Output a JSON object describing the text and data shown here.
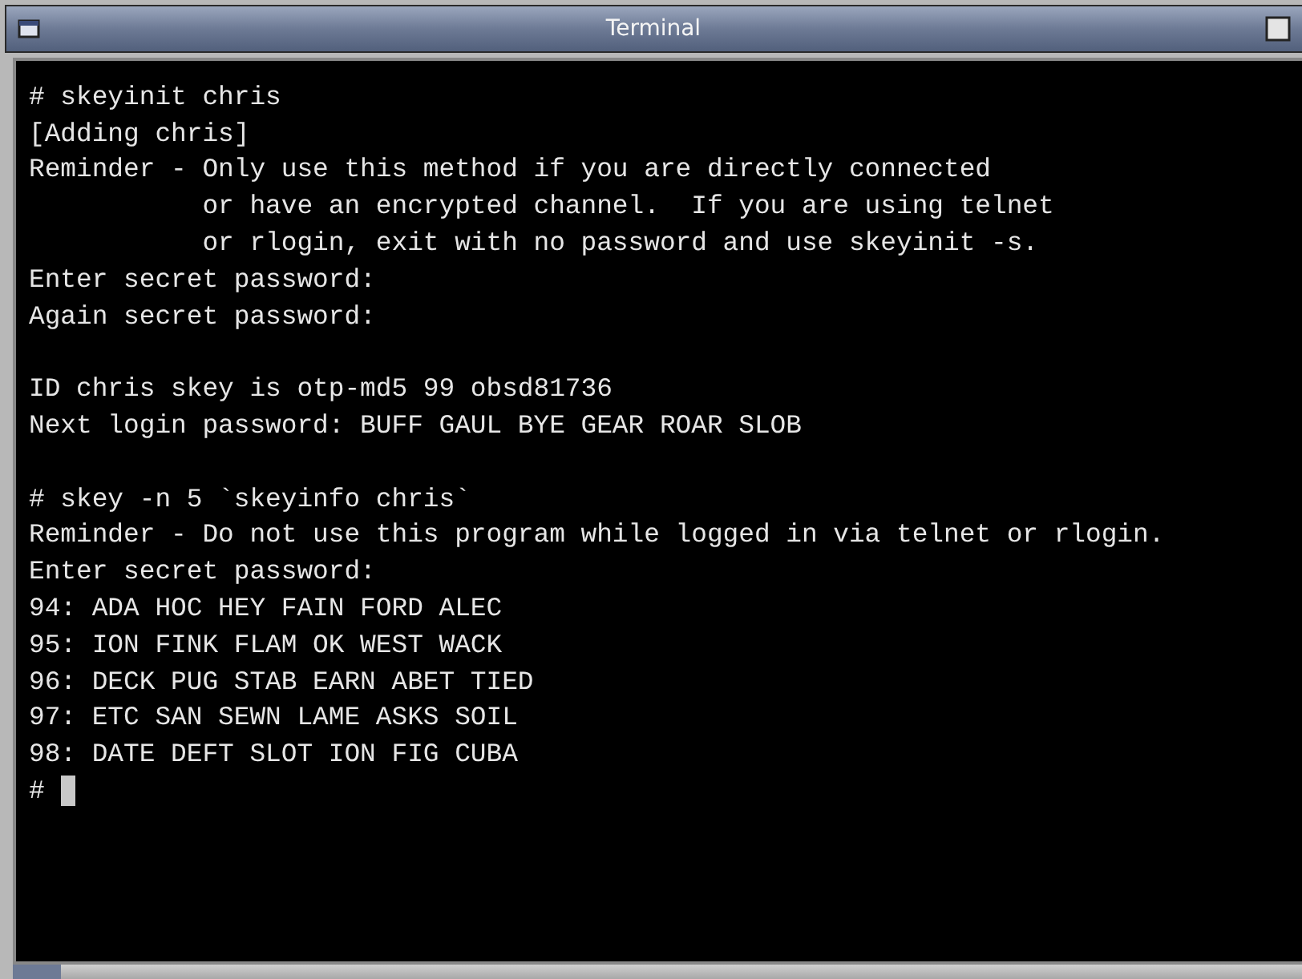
{
  "window": {
    "title": "Terminal"
  },
  "lines": [
    {
      "kind": "text",
      "text": "# skeyinit chris"
    },
    {
      "kind": "text",
      "text": "[Adding chris]"
    },
    {
      "kind": "text",
      "text": "Reminder - Only use this method if you are directly connected"
    },
    {
      "kind": "text",
      "text": "           or have an encrypted channel.  If you are using telnet"
    },
    {
      "kind": "text",
      "text": "           or rlogin, exit with no password and use skeyinit -s."
    },
    {
      "kind": "text",
      "text": "Enter secret password:"
    },
    {
      "kind": "text",
      "text": "Again secret password:"
    },
    {
      "kind": "blank"
    },
    {
      "kind": "text",
      "text": "ID chris skey is otp-md5 99 obsd81736"
    },
    {
      "kind": "text",
      "text": "Next login password: BUFF GAUL BYE GEAR ROAR SLOB"
    },
    {
      "kind": "blank"
    },
    {
      "kind": "text",
      "text": "# skey -n 5 `skeyinfo chris`"
    },
    {
      "kind": "text",
      "text": "Reminder - Do not use this program while logged in via telnet or rlogin."
    },
    {
      "kind": "text",
      "text": "Enter secret password:"
    },
    {
      "kind": "text",
      "text": "94: ADA HOC HEY FAIN FORD ALEC"
    },
    {
      "kind": "text",
      "text": "95: ION FINK FLAM OK WEST WACK"
    },
    {
      "kind": "text",
      "text": "96: DECK PUG STAB EARN ABET TIED"
    },
    {
      "kind": "text",
      "text": "97: ETC SAN SEWN LAME ASKS SOIL"
    },
    {
      "kind": "text",
      "text": "98: DATE DEFT SLOT ION FIG CUBA"
    },
    {
      "kind": "prompt",
      "text": "#"
    }
  ]
}
